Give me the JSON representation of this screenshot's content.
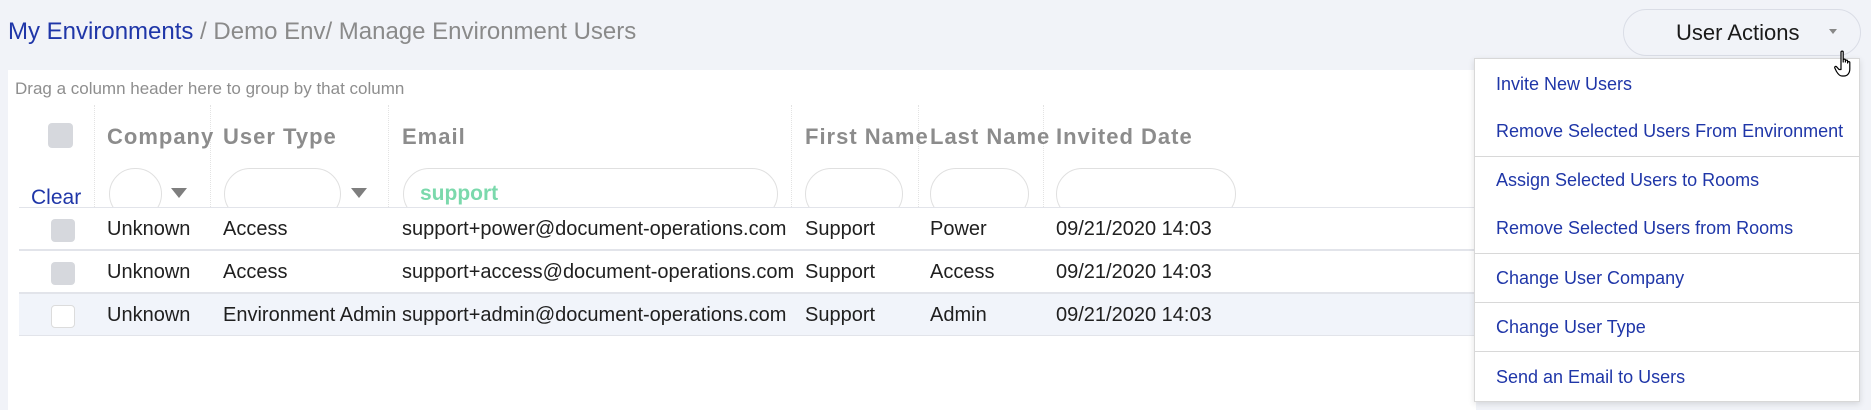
{
  "breadcrumb": {
    "root": "My Environments",
    "rest": " / Demo Env/ Manage Environment Users"
  },
  "user_actions": {
    "label": "User Actions",
    "menu_groups": [
      [
        "Invite New Users",
        "Remove Selected Users From Environment"
      ],
      [
        "Assign Selected Users to Rooms",
        "Remove Selected Users from Rooms"
      ],
      [
        "Change User Company"
      ],
      [
        "Change User Type"
      ],
      [
        "Send an Email to Users"
      ]
    ]
  },
  "grid": {
    "group_hint": "Drag a column header here to group by that column",
    "clear_label": "Clear",
    "columns": [
      "Company",
      "User Type",
      "Email",
      "First Name",
      "Last Name",
      "Invited Date"
    ],
    "filters": {
      "company": "",
      "user_type": "",
      "email": "support",
      "first_name": "",
      "last_name": "",
      "invited_date": ""
    },
    "rows": [
      {
        "company": "Unknown",
        "user_type": "Access",
        "email": "support+power@document-operations.com",
        "first_name": "Support",
        "last_name": "Power",
        "invited_date": "09/21/2020 14:03"
      },
      {
        "company": "Unknown",
        "user_type": "Access",
        "email": "support+access@document-operations.com",
        "first_name": "Support",
        "last_name": "Access",
        "invited_date": "09/21/2020 14:03"
      },
      {
        "company": "Unknown",
        "user_type": "Environment Admin",
        "email": "support+admin@document-operations.com",
        "first_name": "Support",
        "last_name": "Admin",
        "invited_date": "09/21/2020 14:03"
      }
    ]
  },
  "colors": {
    "link_blue": "#1f36a8",
    "filter_text_green": "#7bd9ac",
    "page_background": "#f1f3f8"
  }
}
